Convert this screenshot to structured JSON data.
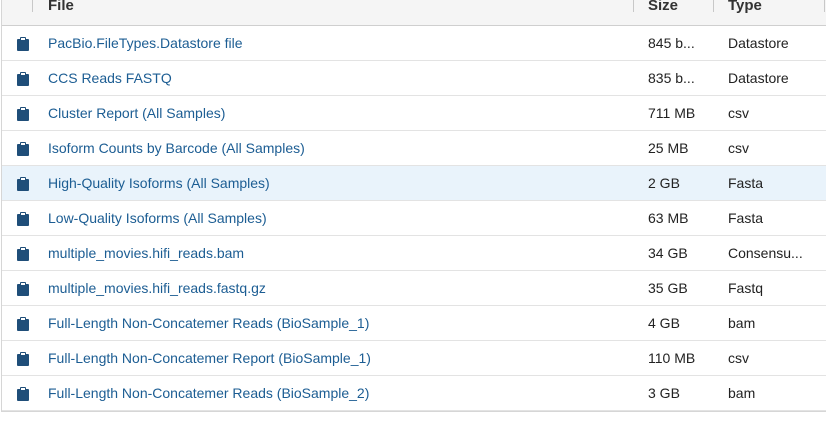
{
  "header": {
    "file": "File",
    "size": "Size",
    "type": "Type"
  },
  "rows": [
    {
      "name": "PacBio.FileTypes.Datastore file",
      "size": "845 b...",
      "type": "Datastore",
      "selected": false
    },
    {
      "name": "CCS Reads FASTQ",
      "size": "835 b...",
      "type": "Datastore",
      "selected": false
    },
    {
      "name": "Cluster Report (All Samples)",
      "size": "711 MB",
      "type": "csv",
      "selected": false
    },
    {
      "name": "Isoform Counts by Barcode (All Samples)",
      "size": "25 MB",
      "type": "csv",
      "selected": false
    },
    {
      "name": "High-Quality Isoforms (All Samples)",
      "size": "2 GB",
      "type": "Fasta",
      "selected": true
    },
    {
      "name": "Low-Quality Isoforms (All Samples)",
      "size": "63 MB",
      "type": "Fasta",
      "selected": false
    },
    {
      "name": "multiple_movies.hifi_reads.bam",
      "size": "34 GB",
      "type": "Consensu...",
      "selected": false
    },
    {
      "name": "multiple_movies.hifi_reads.fastq.gz",
      "size": "35 GB",
      "type": "Fastq",
      "selected": false
    },
    {
      "name": "Full-Length Non-Concatemer Reads (BioSample_1)",
      "size": "4 GB",
      "type": "bam",
      "selected": false
    },
    {
      "name": "Full-Length Non-Concatemer Report (BioSample_1)",
      "size": "110 MB",
      "type": "csv",
      "selected": false
    },
    {
      "name": "Full-Length Non-Concatemer Reads (BioSample_2)",
      "size": "3 GB",
      "type": "bam",
      "selected": false
    }
  ],
  "icon": "clipboard-icon",
  "colors": {
    "link": "#1c5d93",
    "icon": "#1f4e79",
    "selected_row": "#e9f3fb",
    "header_bg": "#f5f5f5"
  }
}
